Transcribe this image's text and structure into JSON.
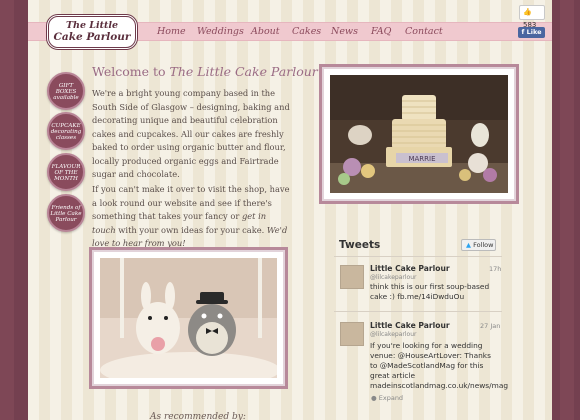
{
  "brand": {
    "logo_line1": "The Little",
    "logo_line2": "Cake Parlour"
  },
  "nav": {
    "items": [
      "Home",
      "Weddings",
      "About",
      "Cakes",
      "News",
      "FAQ",
      "Contact"
    ]
  },
  "facebook": {
    "like_count": "583",
    "like_label": "Like"
  },
  "badges": [
    {
      "lines": [
        "GIFT",
        "BOXES",
        "available"
      ]
    },
    {
      "lines": [
        "CUPCAKE",
        "decorating",
        "classes"
      ]
    },
    {
      "lines": [
        "FLAVOUR",
        "OF THE",
        "MONTH"
      ]
    },
    {
      "lines": [
        "Friends of",
        "Little Cake",
        "Parlour"
      ]
    }
  ],
  "welcome": {
    "prefix": "Welcome to ",
    "name": "The Little Cake Parlour"
  },
  "paragraph1": "We're a bright young company based in the South Side of Glasgow – designing, baking and decorating unique and beautiful celebration cakes and cupcakes. All our cakes are freshly baked to order using organic butter and flour, locally produced organic eggs and Fairtrade sugar and chocolate.",
  "paragraph2": {
    "text_a": "If you can't make it over to visit the shop, have a look round our website and see if there's something that takes your fancy or ",
    "link": "get in touch",
    "text_b": " with your own ideas for your cake. ",
    "closing": "We'd love to hear from you!"
  },
  "photo_caption_banner": "MARRIE",
  "tweets": {
    "title": "Tweets",
    "follow_label": "Follow",
    "items": [
      {
        "name": "Little Cake Parlour",
        "handle": "@lilcakeparlour",
        "time": "17h",
        "text": "think this is our first soup-based cake :) fb.me/14iDwduOu"
      },
      {
        "name": "Little Cake Parlour",
        "handle": "@lilcakeparlour",
        "time": "27 Jan",
        "text": "If you're looking for a wedding venue: @HouseArtLover: Thanks to @MadeScotlandMag for this great article madeinscotlandmag.co.uk/news/mag"
      }
    ],
    "expand_label": "Expand"
  },
  "recommended": "As recommended by:",
  "colors": {
    "background_plum": "#7a4452",
    "nav_pink": "#f0c9cf",
    "accent_plum": "#8b4a5c",
    "welcome_mauve": "#9a6b84"
  }
}
